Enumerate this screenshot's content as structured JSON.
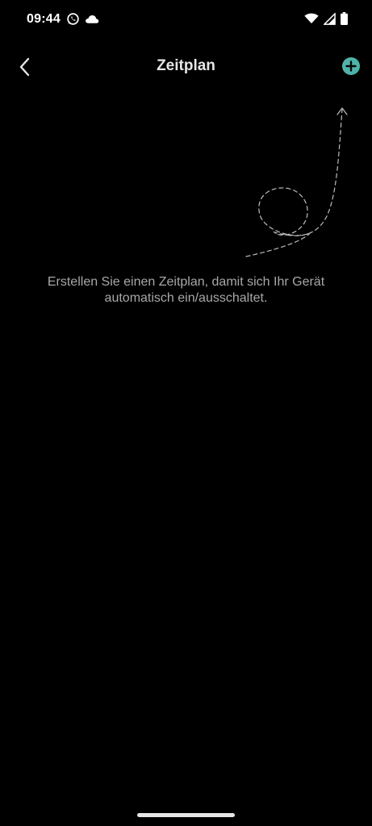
{
  "status_bar": {
    "time": "09:44",
    "left_icons": [
      "whatsapp-icon",
      "cloud-icon"
    ],
    "right_icons": [
      "wifi-icon",
      "cellular-signal-icon",
      "battery-icon"
    ]
  },
  "header": {
    "title": "Zeitplan",
    "back_icon": "chevron-left-icon",
    "add_icon": "plus-circle-icon"
  },
  "empty_state": {
    "line1": "Erstellen Sie einen Zeitplan, damit sich Ihr Gerät",
    "line2": "automatisch ein/ausschaltet."
  },
  "colors": {
    "background": "#000000",
    "accent": "#4fb3a9",
    "title_text": "#e6e6e6",
    "body_text": "#a8a8a8"
  }
}
